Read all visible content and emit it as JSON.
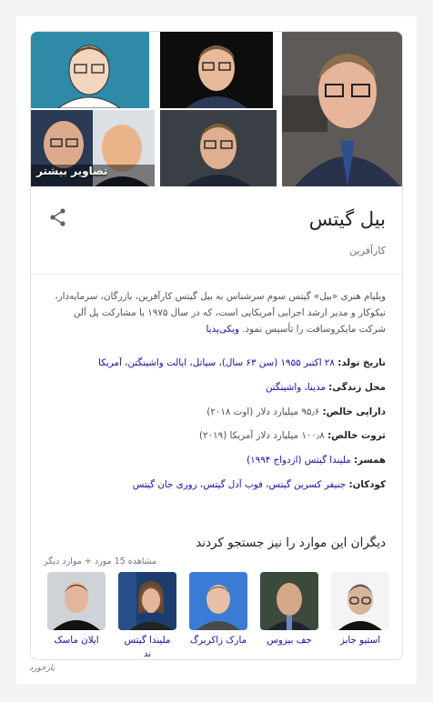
{
  "images": {
    "more_label": "تصاویر بیشتر"
  },
  "header": {
    "title": "بیل گیتس",
    "subtitle": "کارآفرین",
    "share_icon": "share-icon"
  },
  "description": {
    "text": "ویلیام هنری «بیل» گیتس سوم سرشناس به بیل گیتس کارآفرین، بازرگان، سرمایه‌دار، نیکوکار و مدیر ارشد اجرایی آمریکایی است، که در سال ۱۹۷۵ با مشارکت پل آلن شرکت مایکروسافت را تأسیس نمود.",
    "source": "ویکی‌پدیا"
  },
  "facts": [
    {
      "label": "تاریخ تولد:",
      "value": "۲۸ اکتبر ۱۹۵۵ (سن ۶۳ سال)، سیاتل، ایالت واشینگتن، آمریکا"
    },
    {
      "label": "محل زندگی:",
      "value": "مدینا، واشینگتن"
    },
    {
      "label": "دارایی خالص:",
      "value": "۹۵٫۶ میلیارد دلار (اوت ۲۰۱۸)"
    },
    {
      "label": "ثروت خالص:",
      "value": "۱۰۰٫۸ میلیارد دلار آمریکا (۲۰۱۹)",
      "plain": true
    },
    {
      "label": "همسر:",
      "value": "ملیندا گیتس (ازدواج ۱۹۹۴)"
    },
    {
      "label": "کودکان:",
      "value": "جنیفر کسرین گیتس، فوب آدل گیتس، روری جان گیتس"
    }
  ],
  "people_also_search": {
    "title": "دیگران این موارد را نیز جستجو کردند",
    "more": "مشاهده 15 مورد + موارد دیگر",
    "people": [
      {
        "name": "استیو جابز"
      },
      {
        "name": "جف بیزوس"
      },
      {
        "name": "مارک زاکربرگ"
      },
      {
        "name": "ملیندا گیتس\nند"
      },
      {
        "name": "ایلان ماسک"
      }
    ]
  },
  "feedback": "بازخورد"
}
